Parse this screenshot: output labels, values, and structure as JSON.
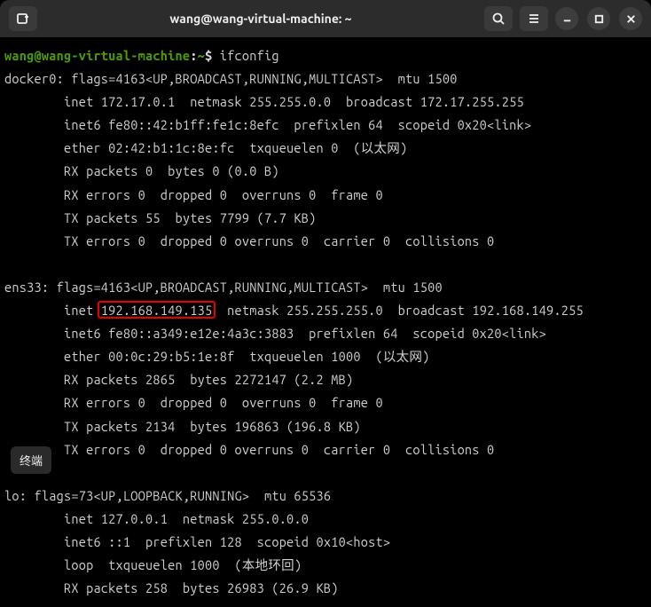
{
  "titlebar": {
    "title": "wang@wang-virtual-machine: ~"
  },
  "prompt": {
    "userhost": "wang@wang-virtual-machine",
    "sep": ":",
    "path": "~",
    "dollar": "$ "
  },
  "command": "ifconfig",
  "highlight_ip": "192.168.149.135",
  "side_tag": "终端",
  "output": {
    "l1": "docker0: flags=4163<UP,BROADCAST,RUNNING,MULTICAST>  mtu 1500",
    "l2": "        inet 172.17.0.1  netmask 255.255.0.0  broadcast 172.17.255.255",
    "l3": "        inet6 fe80::42:b1ff:fe1c:8efc  prefixlen 64  scopeid 0x20<link>",
    "l4": "        ether 02:42:b1:1c:8e:fc  txqueuelen 0  (以太网)",
    "l5": "        RX packets 0  bytes 0 (0.0 B)",
    "l6": "        RX errors 0  dropped 0  overruns 0  frame 0",
    "l7": "        TX packets 55  bytes 7799 (7.7 KB)",
    "l8": "        TX errors 0  dropped 0 overruns 0  carrier 0  collisions 0",
    "blank1": "",
    "l9": "ens33: flags=4163<UP,BROADCAST,RUNNING,MULTICAST>  mtu 1500",
    "l10a": "        inet ",
    "l10b": "  netmask 255.255.255.0  broadcast 192.168.149.255",
    "l11": "        inet6 fe80::a349:e12e:4a3c:3883  prefixlen 64  scopeid 0x20<link>",
    "l12": "        ether 00:0c:29:b5:1e:8f  txqueuelen 1000  (以太网)",
    "l13": "        RX packets 2865  bytes 2272147 (2.2 MB)",
    "l14": "        RX errors 0  dropped 0  overruns 0  frame 0",
    "l15": "        TX packets 2134  bytes 196863 (196.8 KB)",
    "l16": "        TX errors 0  dropped 0 overruns 0  carrier 0  collisions 0",
    "blank2": "",
    "l17": "lo: flags=73<UP,LOOPBACK,RUNNING>  mtu 65536",
    "l18": "        inet 127.0.0.1  netmask 255.0.0.0",
    "l19": "        inet6 ::1  prefixlen 128  scopeid 0x10<host>",
    "l20": "        loop  txqueuelen 1000  (本地环回)",
    "l21": "        RX packets 258  bytes 26983 (26.9 KB)"
  }
}
